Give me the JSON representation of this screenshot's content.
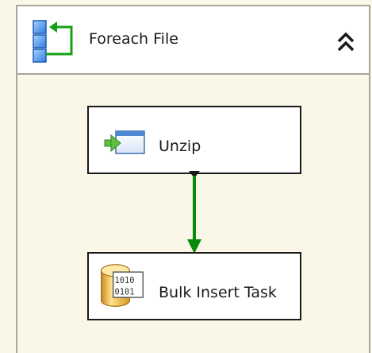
{
  "container": {
    "title": "Foreach File",
    "icon": "foreach-loop-icon",
    "collapse_icon": "double-chevron-up-icon"
  },
  "tasks": [
    {
      "label": "Unzip",
      "icon": "execute-process-icon"
    },
    {
      "label": "Bulk Insert Task",
      "icon": "bulk-insert-database-icon"
    }
  ],
  "connector": {
    "type": "success",
    "color": "#0A8A0A"
  },
  "colors": {
    "background": "#FBF7E8",
    "border": "#AAA59B",
    "task_border": "#1A1A1A"
  }
}
